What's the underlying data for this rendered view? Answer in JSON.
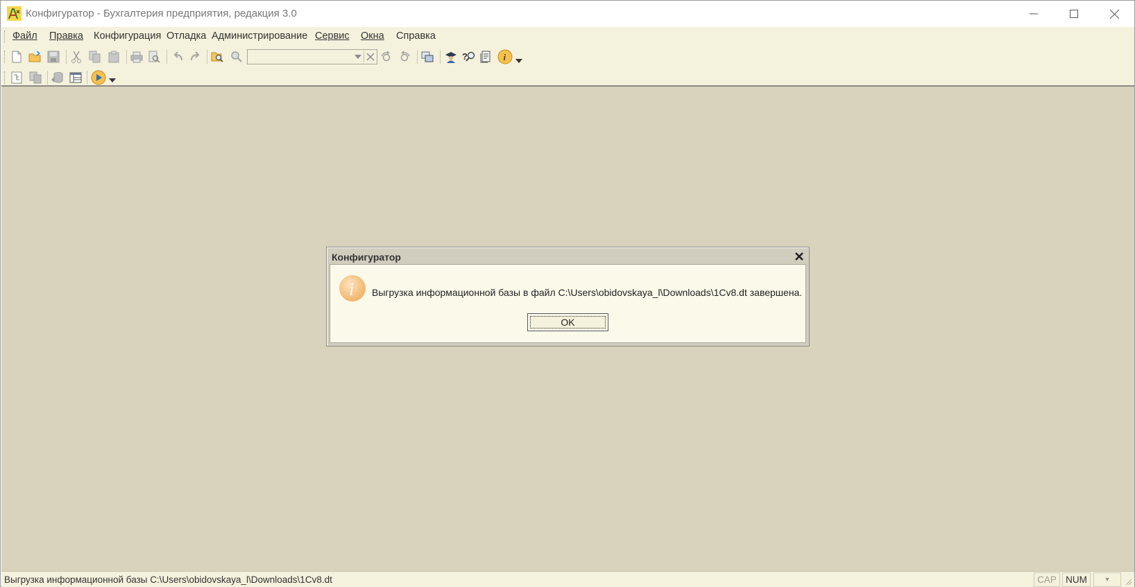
{
  "window": {
    "title": "Конфигуратор - Бухгалтерия предприятия, редакция 3.0",
    "controls": {
      "minimize": "—",
      "maximize": "☐",
      "close": "✕"
    }
  },
  "menubar": {
    "items": [
      {
        "label": "Файл",
        "icon": "menu-file"
      },
      {
        "label": "Правка",
        "icon": "menu-edit"
      },
      {
        "label": "Конфигурация",
        "icon": "menu-configuration"
      },
      {
        "label": "Отладка",
        "icon": "menu-debug"
      },
      {
        "label": "Администрирование",
        "icon": "menu-administration"
      },
      {
        "label": "Сервис",
        "icon": "menu-service"
      },
      {
        "label": "Окна",
        "icon": "menu-windows"
      },
      {
        "label": "Справка",
        "icon": "menu-help"
      }
    ]
  },
  "toolbar1": {
    "buttons": [
      "new-document-icon",
      "open-icon",
      "save-icon",
      "cut-icon",
      "copy-icon",
      "paste-icon",
      "print-icon",
      "print-preview-icon",
      "undo-icon",
      "redo-icon",
      "find-in-files-icon",
      "search-icon"
    ],
    "search": {
      "value": "",
      "placeholder": ""
    },
    "buttons_after": [
      "find-next-icon",
      "find-previous-icon",
      "windows-list-icon",
      "syntax-assistant-icon",
      "help-search-icon",
      "help-contents-icon",
      "info-icon"
    ]
  },
  "toolbar2": {
    "buttons": [
      "open-configuration-icon",
      "compare-configurations-icon",
      "update-database-icon",
      "configuration-tree-icon",
      "start-debugging-icon"
    ]
  },
  "dialog": {
    "title": "Конфигуратор",
    "message": "Выгрузка информационной базы в файл C:\\Users\\obidovskaya_l\\Downloads\\1Cv8.dt завершена.",
    "ok_label": "OK"
  },
  "statusbar": {
    "text": "Выгрузка информационной базы C:\\Users\\obidovskaya_l\\Downloads\\1Cv8.dt",
    "cap": "CAP",
    "num": "NUM",
    "dropdown": "▾"
  },
  "colors": {
    "chrome_bg": "#f4f1dd",
    "workspace_bg": "#d9d3bd",
    "dialog_body_bg": "#fbf9ea",
    "info_icon_orange": "#f2b46a"
  }
}
